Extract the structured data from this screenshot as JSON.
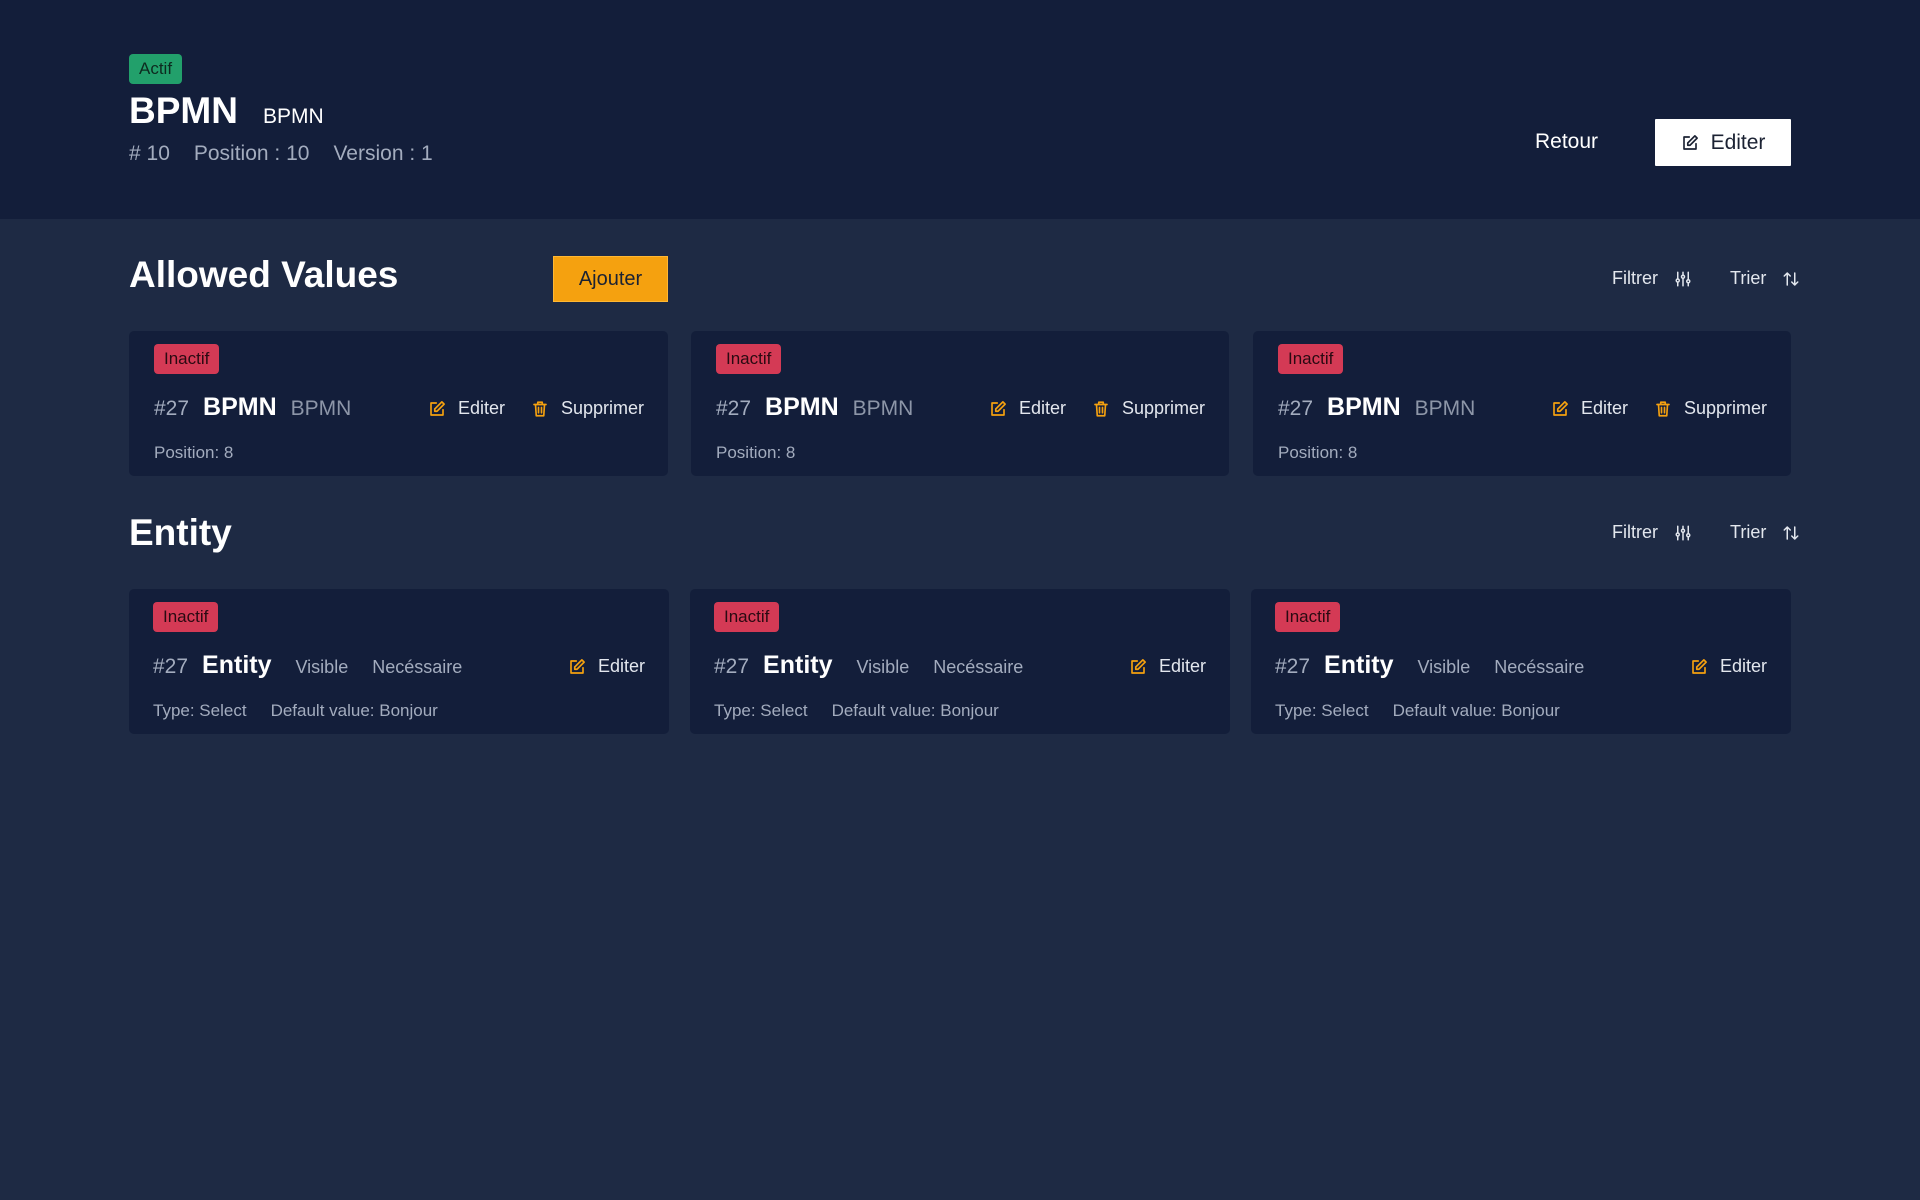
{
  "header": {
    "status": "Actif",
    "title": "BPMN",
    "subtitle": "BPMN",
    "id": "# 10",
    "position": "Position : 10",
    "version": "Version : 1",
    "back_label": "Retour",
    "edit_label": "Editer"
  },
  "allowed_values": {
    "title": "Allowed Values",
    "add_label": "Ajouter",
    "filter_label": "Filtrer",
    "sort_label": "Trier",
    "cards": [
      {
        "status": "Inactif",
        "num": "#27",
        "name": "BPMN",
        "code": "BPMN",
        "edit": "Editer",
        "delete": "Supprimer",
        "position": "Position: 8"
      },
      {
        "status": "Inactif",
        "num": "#27",
        "name": "BPMN",
        "code": "BPMN",
        "edit": "Editer",
        "delete": "Supprimer",
        "position": "Position: 8"
      },
      {
        "status": "Inactif",
        "num": "#27",
        "name": "BPMN",
        "code": "BPMN",
        "edit": "Editer",
        "delete": "Supprimer",
        "position": "Position: 8"
      }
    ]
  },
  "entity": {
    "title": "Entity",
    "filter_label": "Filtrer",
    "sort_label": "Trier",
    "cards": [
      {
        "status": "Inactif",
        "num": "#27",
        "name": "Entity",
        "visible": "Visible",
        "required": "Necéssaire",
        "edit": "Editer",
        "type": "Type: Select",
        "default": "Default value: Bonjour"
      },
      {
        "status": "Inactif",
        "num": "#27",
        "name": "Entity",
        "visible": "Visible",
        "required": "Necéssaire",
        "edit": "Editer",
        "type": "Type: Select",
        "default": "Default value: Bonjour"
      },
      {
        "status": "Inactif",
        "num": "#27",
        "name": "Entity",
        "visible": "Visible",
        "required": "Necéssaire",
        "edit": "Editer",
        "type": "Type: Select",
        "default": "Default value: Bonjour"
      }
    ]
  },
  "colors": {
    "header_bg": "#131e3a",
    "page_bg": "#1e2a44",
    "accent": "#f5a10f",
    "active": "#22a06b",
    "inactive": "#d43a55"
  },
  "icons": [
    "pencil-square-icon",
    "trash-icon",
    "sliders-icon",
    "sort-arrows-icon"
  ]
}
